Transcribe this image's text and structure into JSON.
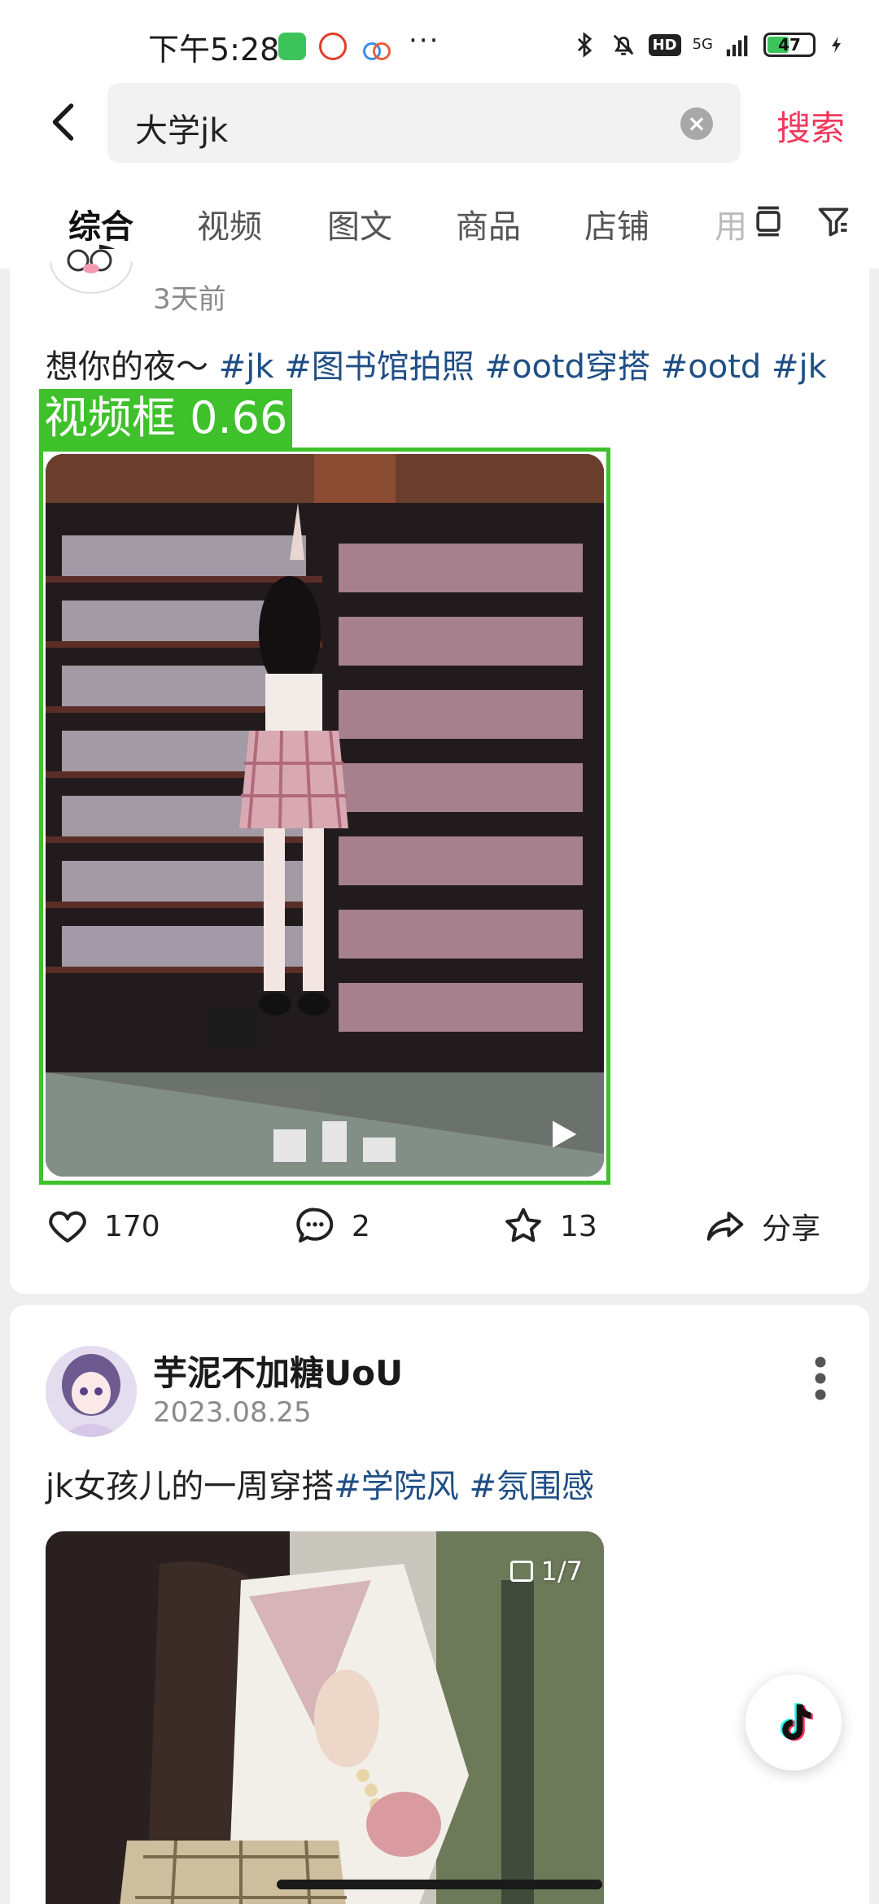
{
  "status_bar": {
    "time": "下午5:28",
    "more": "···",
    "network": "5G",
    "hd": "HD",
    "battery": "47"
  },
  "search": {
    "query": "大学jk",
    "button": "搜索"
  },
  "tabs": [
    {
      "label": "综合"
    },
    {
      "label": "视频"
    },
    {
      "label": "图文"
    },
    {
      "label": "商品"
    },
    {
      "label": "店铺"
    },
    {
      "label": "用"
    }
  ],
  "post1": {
    "time": "3天前",
    "caption_text": "想你的夜～",
    "tags": [
      "#jk",
      "#图书馆拍照",
      "#ootd穿搭",
      "#ootd",
      "#jk"
    ],
    "detection_label": "视频框 0.66",
    "likes": "170",
    "comments": "2",
    "stars": "13",
    "share": "分享"
  },
  "post2": {
    "author": "芋泥不加糖UoU",
    "date": "2023.08.25",
    "caption_text": "jk女孩儿的一周穿搭",
    "tags": [
      "#学院风",
      "#氛围感"
    ],
    "page_count": "1/7"
  },
  "colors": {
    "accent": "#f2385c",
    "tag": "#1f4e85",
    "detection": "#3ec12b"
  }
}
